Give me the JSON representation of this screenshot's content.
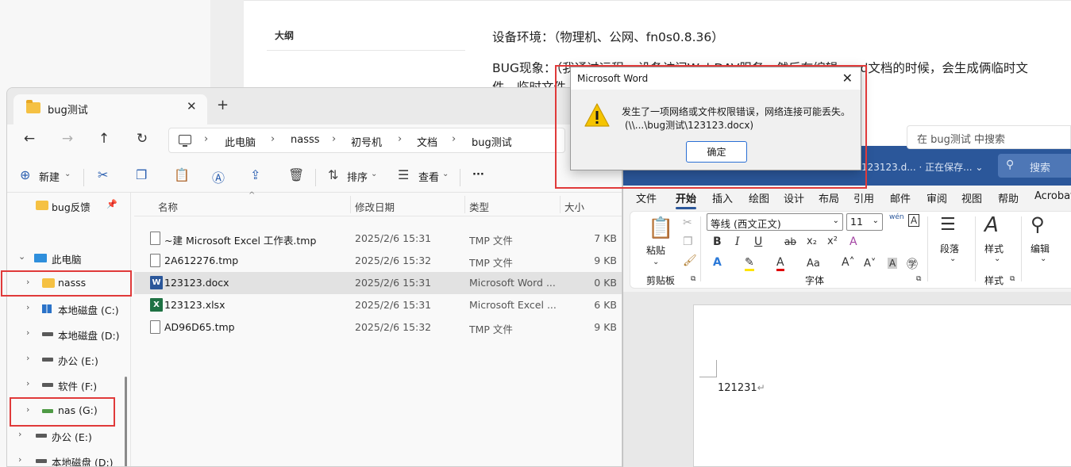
{
  "background_doc": {
    "outline_title": "大纲",
    "line1": "设备环境：（物理机、公网、fn0s0.8.36）",
    "line2": "BUG现象：（我通过远程ns设备访问WebDAV服务，然后在编辑word文档的时候，会生成俩临时文",
    "line3": "件，临时文件"
  },
  "explorer": {
    "tab_title": "bug测试",
    "tab_close": "✕",
    "new_tab": "+",
    "nav": {
      "back": "←",
      "forward": "→",
      "up": "↑",
      "refresh": "↻"
    },
    "breadcrumb": [
      "此电脑",
      "nasss",
      "初号机",
      "文档",
      "bug测试"
    ],
    "breadcrumb_sep": "›",
    "search_placeholder": "在 bug测试 中搜索",
    "toolbar": {
      "new": "新建",
      "sort": "排序",
      "view": "查看",
      "more": "···",
      "chev": "⌄"
    },
    "nav_pane": [
      {
        "label": "bug反馈",
        "kind": "folder",
        "pinned": true
      },
      {
        "label": "此电脑",
        "kind": "pc",
        "expanded": true
      },
      {
        "label": "nasss",
        "kind": "folder"
      },
      {
        "label": "本地磁盘 (C:)",
        "kind": "win"
      },
      {
        "label": "本地磁盘 (D:)",
        "kind": "drive"
      },
      {
        "label": "办公 (E:)",
        "kind": "drive"
      },
      {
        "label": "软件 (F:)",
        "kind": "drive"
      },
      {
        "label": "nas (G:)",
        "kind": "nas"
      },
      {
        "label": "办公 (E:)",
        "kind": "drive"
      },
      {
        "label": "本地磁盘 (D:)",
        "kind": "drive"
      }
    ],
    "columns": {
      "name": "名称",
      "date": "修改日期",
      "type": "类型",
      "size": "大小"
    },
    "files": [
      {
        "name": "~建 Microsoft Excel 工作表.tmp",
        "date": "2025/2/6 15:31",
        "type": "TMP 文件",
        "size": "7 KB",
        "icon": "file"
      },
      {
        "name": "2A612276.tmp",
        "date": "2025/2/6 15:32",
        "type": "TMP 文件",
        "size": "9 KB",
        "icon": "file"
      },
      {
        "name": "123123.docx",
        "date": "2025/2/6 15:31",
        "type": "Microsoft Word ...",
        "size": "0 KB",
        "icon": "word",
        "selected": true
      },
      {
        "name": "123123.xlsx",
        "date": "2025/2/6 15:31",
        "type": "Microsoft Excel ...",
        "size": "6 KB",
        "icon": "excel"
      },
      {
        "name": "AD96D65.tmp",
        "date": "2025/2/6 15:32",
        "type": "TMP 文件",
        "size": "9 KB",
        "icon": "file"
      }
    ]
  },
  "word": {
    "title": "123123.d... · 正在保存... ⌄",
    "search_label": "搜索",
    "tabs": [
      "文件",
      "开始",
      "插入",
      "绘图",
      "设计",
      "布局",
      "引用",
      "邮件",
      "审阅",
      "视图",
      "帮助",
      "Acrobat"
    ],
    "active_tab": "开始",
    "ribbon": {
      "paste": "粘贴",
      "clipboard": "剪贴板",
      "font_name": "等线 (西文正文)",
      "font_size": "11",
      "font_group": "字体",
      "paragraph": "段落",
      "styles": "样式",
      "styles_group": "样式",
      "editing": "编辑",
      "bold": "B",
      "italic": "I",
      "underline": "U",
      "strike": "ab",
      "sub": "x₂",
      "sup": "x²"
    },
    "doc_text": "121231",
    "para_mark": "↵"
  },
  "dialog": {
    "title": "Microsoft Word",
    "close": "✕",
    "message_line1": "发生了一项网络或文件权限错误，网络连接可能丢失。",
    "message_line2": "(\\\\...\\bug测试\\123123.docx)",
    "ok_label": "确定",
    "warning_color": "#f5c400"
  },
  "annotation_color": "#e03a3a"
}
